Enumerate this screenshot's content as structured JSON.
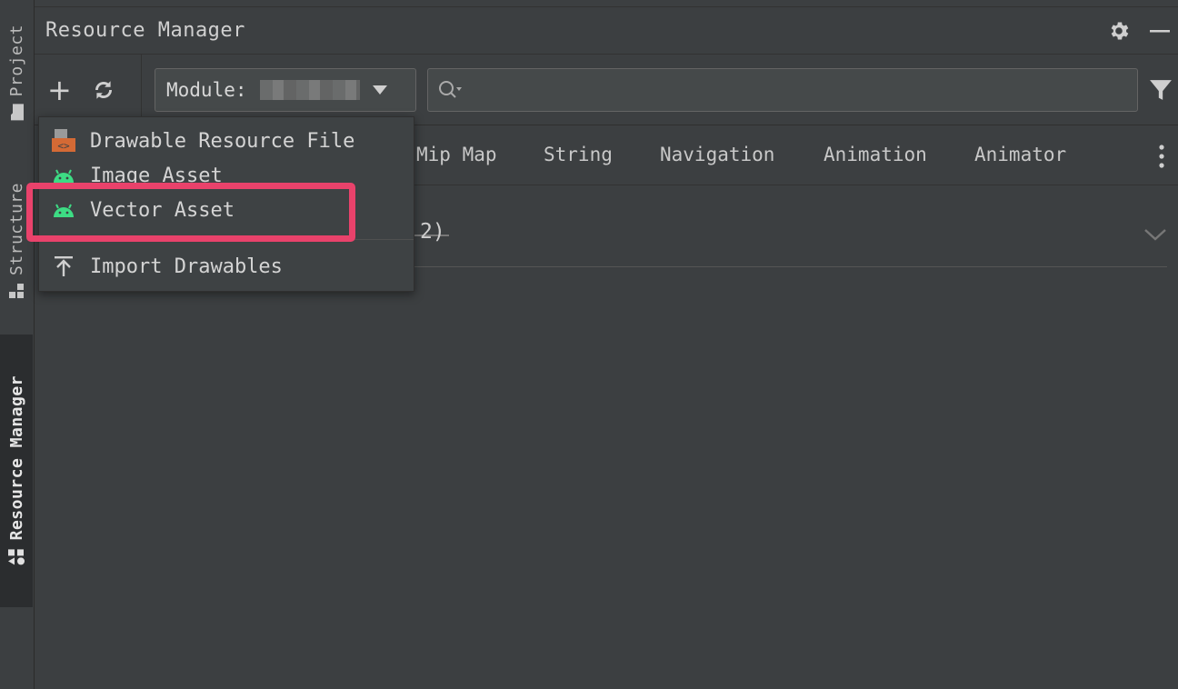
{
  "side_tabs": {
    "project": "Project",
    "structure": "Structure",
    "resource_manager": "Resource Manager"
  },
  "panel": {
    "title": "Resource Manager"
  },
  "toolbar": {
    "module_label": "Module:",
    "search_placeholder": ""
  },
  "tabs": [
    "Mip Map",
    "String",
    "Navigation",
    "Animation",
    "Animator"
  ],
  "section": {
    "count_fragment": "2)"
  },
  "add_menu": {
    "items": [
      {
        "label": "Drawable Resource File",
        "icon": "drawable-file-icon"
      },
      {
        "label": "Image Asset",
        "icon": "android-icon"
      },
      {
        "label": "Vector Asset",
        "icon": "android-icon",
        "highlighted": true
      },
      {
        "label": "Import Drawables",
        "icon": "import-icon"
      }
    ]
  },
  "colors": {
    "background": "#3c3f41",
    "highlight": "#e9426b",
    "android_green": "#3ddc84"
  }
}
